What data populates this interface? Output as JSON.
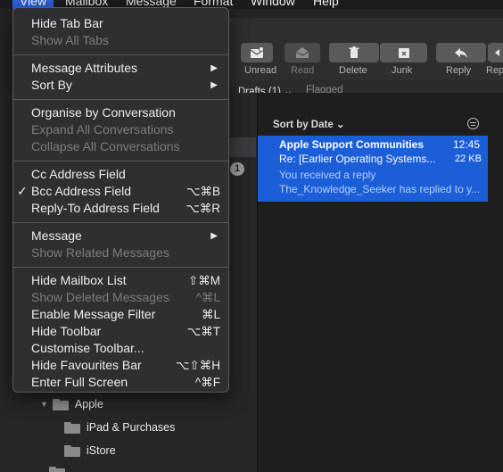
{
  "menubar": {
    "items": [
      "View",
      "Mailbox",
      "Message",
      "Format",
      "Window",
      "Help"
    ]
  },
  "toolbar": {
    "buttons": [
      {
        "label": "Unread",
        "icon": "envelope-icon"
      },
      {
        "label": "Read",
        "icon": "envelope-open-icon"
      },
      {
        "label": "Delete",
        "icon": "trash-icon"
      },
      {
        "label": "Junk",
        "icon": "junk-icon"
      },
      {
        "label": "Reply",
        "icon": "reply-icon"
      },
      {
        "label": "Rep",
        "icon": "reply-all-icon"
      }
    ]
  },
  "favorites": {
    "drafts": "Drafts (1) ⌄",
    "flagged": "Flagged"
  },
  "sidebar": {
    "badge": "1",
    "folders": [
      {
        "label": "Apple"
      },
      {
        "label": "iPad & Purchases"
      },
      {
        "label": "iStore"
      }
    ]
  },
  "list": {
    "sort_label": "Sort by Date ⌄",
    "message": {
      "sender": "Apple Support Communities",
      "time": "12:45",
      "subject": "Re:  [Earlier Operating Systems...",
      "size": "22 KB",
      "preview_line1": "You received a reply",
      "preview_line2": "The_Knowledge_Seeker has replied to y..."
    }
  },
  "menu": {
    "items": [
      {
        "label": "Hide Tab Bar",
        "shortcut": "",
        "enabled": true
      },
      {
        "label": "Show All Tabs",
        "shortcut": "",
        "enabled": false
      },
      {
        "label": "Message Attributes",
        "shortcut": "▶",
        "enabled": true
      },
      {
        "label": "Sort By",
        "shortcut": "▶",
        "enabled": true
      },
      {
        "label": "Organise by Conversation",
        "shortcut": "",
        "enabled": true
      },
      {
        "label": "Expand All Conversations",
        "shortcut": "",
        "enabled": false
      },
      {
        "label": "Collapse All Conversations",
        "shortcut": "",
        "enabled": false
      },
      {
        "label": "Cc Address Field",
        "shortcut": "",
        "enabled": true
      },
      {
        "label": "Bcc Address Field",
        "shortcut": "⌥⌘B",
        "enabled": true,
        "checked": "✓"
      },
      {
        "label": "Reply-To Address Field",
        "shortcut": "⌥⌘R",
        "enabled": true
      },
      {
        "label": "Message",
        "shortcut": "▶",
        "enabled": true
      },
      {
        "label": "Show Related Messages",
        "shortcut": "",
        "enabled": false
      },
      {
        "label": "Hide Mailbox List",
        "shortcut": "⇧⌘M",
        "enabled": true
      },
      {
        "label": "Show Deleted Messages",
        "shortcut": "^⌘L",
        "enabled": false
      },
      {
        "label": "Enable Message Filter",
        "shortcut": "⌘L",
        "enabled": true
      },
      {
        "label": "Hide Toolbar",
        "shortcut": "⌥⌘T",
        "enabled": true
      },
      {
        "label": "Customise Toolbar...",
        "shortcut": "",
        "enabled": true
      },
      {
        "label": "Hide Favourites Bar",
        "shortcut": "⌥⇧⌘H",
        "enabled": true
      },
      {
        "label": "Enter Full Screen",
        "shortcut": "^⌘F",
        "enabled": true
      }
    ]
  },
  "colors": {
    "menu_bg": "#303032",
    "selection": "#1b5ed7",
    "active_menu": "#2a62d8"
  }
}
